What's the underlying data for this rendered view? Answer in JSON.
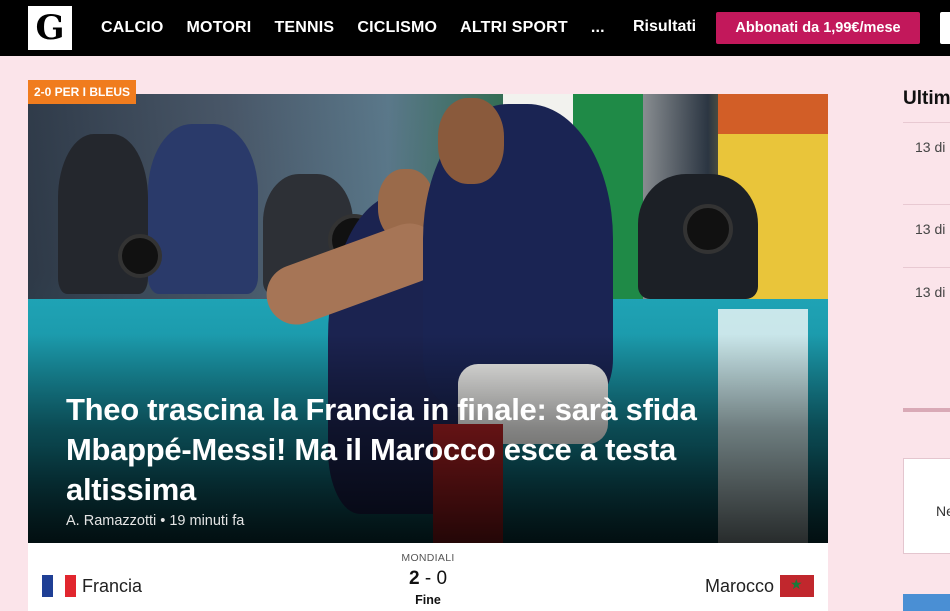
{
  "header": {
    "logo_letter": "G",
    "nav": [
      "CALCIO",
      "MOTORI",
      "TENNIS",
      "CICLISMO",
      "ALTRI SPORT",
      "..."
    ],
    "results_label": "Risultati",
    "subscribe_label": "Abbonati da 1,99€/mese"
  },
  "hero": {
    "kicker": "2-0 PER I BLEUS",
    "headline": "Theo trascina la Francia in finale: sarà sfida Mbappé-Messi! Ma il Marocco esce a testa altissima",
    "author": "A. Ramazzotti",
    "separator": "•",
    "time_ago": "19 minuti fa"
  },
  "match": {
    "competition": "MONDIALI",
    "home_team": "Francia",
    "home_score": "2",
    "score_separator": "-",
    "away_score": "0",
    "away_team": "Marocco",
    "status": "Fine"
  },
  "sidebar": {
    "title": "Ultim",
    "items": [
      "13 di",
      "13 di",
      "13 di"
    ],
    "card_text": "Ne"
  },
  "colors": {
    "page_bg": "#fbe4ea",
    "topbar": "#000000",
    "subscribe": "#c2185b",
    "kicker": "#f07c1e"
  }
}
